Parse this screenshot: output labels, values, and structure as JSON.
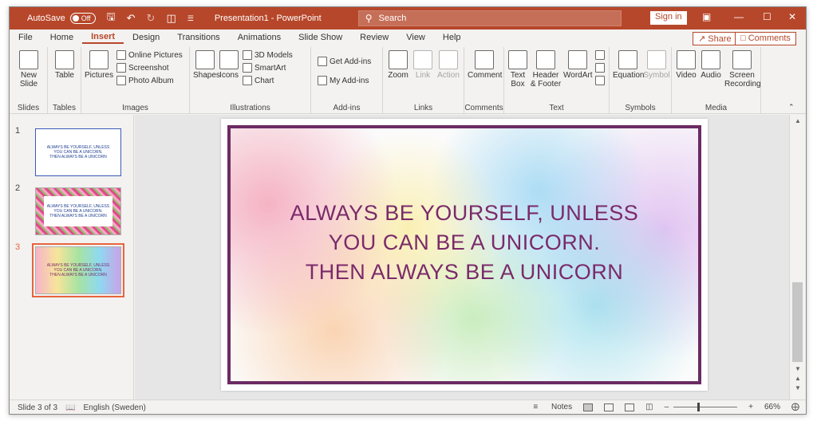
{
  "titlebar": {
    "autosave_label": "AutoSave",
    "autosave_state": "Off",
    "document_title": "Presentation1 - PowerPoint",
    "search_placeholder": "Search",
    "signin_label": "Sign in"
  },
  "menu": {
    "tabs": [
      {
        "label": "File"
      },
      {
        "label": "Home"
      },
      {
        "label": "Insert"
      },
      {
        "label": "Design"
      },
      {
        "label": "Transitions"
      },
      {
        "label": "Animations"
      },
      {
        "label": "Slide Show"
      },
      {
        "label": "Review"
      },
      {
        "label": "View"
      },
      {
        "label": "Help"
      }
    ],
    "share_label": "Share",
    "comments_label": "Comments"
  },
  "ribbon": {
    "slides": {
      "label": "Slides",
      "new_slide": "New Slide"
    },
    "tables": {
      "label": "Tables",
      "table": "Table"
    },
    "images": {
      "label": "Images",
      "pictures": "Pictures",
      "online_pictures": "Online Pictures",
      "screenshot": "Screenshot",
      "photo_album": "Photo Album"
    },
    "illustrations": {
      "label": "Illustrations",
      "shapes": "Shapes",
      "icons": "Icons",
      "models_3d": "3D Models",
      "smartart": "SmartArt",
      "chart": "Chart"
    },
    "addins": {
      "label": "Add-ins",
      "get_addins": "Get Add-ins",
      "my_addins": "My Add-ins"
    },
    "links": {
      "label": "Links",
      "zoom": "Zoom",
      "link": "Link",
      "action": "Action"
    },
    "comments": {
      "label": "Comments",
      "comment": "Comment"
    },
    "text": {
      "label": "Text",
      "text_box_1": "Text",
      "text_box_2": "Box",
      "header_footer_1": "Header",
      "header_footer_2": "& Footer",
      "wordart": "WordArt"
    },
    "symbols": {
      "label": "Symbols",
      "equation": "Equation",
      "symbol": "Symbol"
    },
    "media": {
      "label": "Media",
      "video": "Video",
      "audio": "Audio",
      "screen_recording_1": "Screen",
      "screen_recording_2": "Recording"
    }
  },
  "thumbnails": [
    {
      "number": "1",
      "text_lines": [
        "ALWAYS BE YOURSELF, UNLESS",
        "YOU CAN BE A UNICORN.",
        "THEN ALWAYS BE A UNICORN"
      ]
    },
    {
      "number": "2",
      "text_lines": [
        "ALWAYS BE YOURSELF, UNLESS",
        "YOU CAN BE A UNICORN.",
        "THEN ALWAYS BE A UNICORN"
      ]
    },
    {
      "number": "3",
      "text_lines": [
        "ALWAYS BE YOURSELF, UNLESS",
        "YOU CAN BE A UNICORN.",
        "THEN ALWAYS BE A UNICORN"
      ]
    }
  ],
  "slide": {
    "lines": [
      "ALWAYS BE YOURSELF, UNLESS",
      "YOU CAN BE A UNICORN.",
      "THEN ALWAYS BE A UNICORN"
    ]
  },
  "status": {
    "slide_indicator": "Slide 3 of 3",
    "language": "English (Sweden)",
    "notes_label": "Notes",
    "zoom_level": "66%"
  },
  "colors": {
    "accent": "#b7472a",
    "slide_text": "#7a2a6a",
    "slide_border": "#6b2b63",
    "selected_thumb_outline": "#e8643c"
  }
}
